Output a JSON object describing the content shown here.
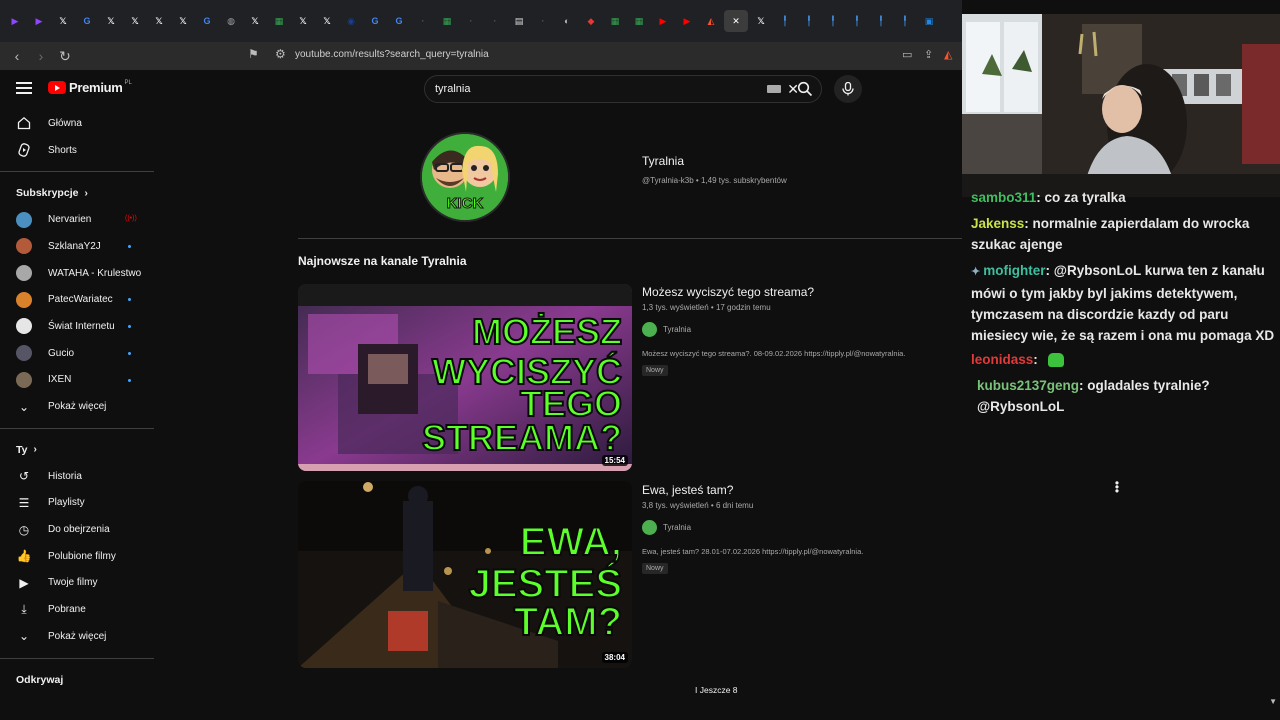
{
  "browser": {
    "tabs": [
      {
        "icon": "twitch-icon",
        "color": "#9146ff",
        "glyph": "▶"
      },
      {
        "icon": "twitch-icon",
        "color": "#9146ff",
        "glyph": "▶"
      },
      {
        "icon": "x-icon",
        "color": "#ffffff",
        "glyph": "𝕏"
      },
      {
        "icon": "google-icon",
        "color": "#4285f4",
        "glyph": "G"
      },
      {
        "icon": "x-icon",
        "color": "#ffffff",
        "glyph": "𝕏"
      },
      {
        "icon": "x-icon",
        "color": "#ffffff",
        "glyph": "𝕏"
      },
      {
        "icon": "x-icon",
        "color": "#ffffff",
        "glyph": "𝕏"
      },
      {
        "icon": "x-icon",
        "color": "#ffffff",
        "glyph": "𝕏"
      },
      {
        "icon": "google-icon",
        "color": "#4285f4",
        "glyph": "G"
      },
      {
        "icon": "globe-icon",
        "color": "#9aa0a6",
        "glyph": "◍"
      },
      {
        "icon": "x-icon",
        "color": "#ffffff",
        "glyph": "𝕏"
      },
      {
        "icon": "sheets-icon",
        "color": "#34a853",
        "glyph": "▦"
      },
      {
        "icon": "x-icon",
        "color": "#ffffff",
        "glyph": "𝕏"
      },
      {
        "icon": "x-icon",
        "color": "#ffffff",
        "glyph": "𝕏"
      },
      {
        "icon": "ford-icon",
        "color": "#1a3e8c",
        "glyph": "◉"
      },
      {
        "icon": "google-icon",
        "color": "#4285f4",
        "glyph": "G"
      },
      {
        "icon": "google-icon",
        "color": "#4285f4",
        "glyph": "G"
      },
      {
        "icon": "blank-icon",
        "color": "#555555",
        "glyph": "·"
      },
      {
        "icon": "sheets-icon",
        "color": "#34a853",
        "glyph": "▦"
      },
      {
        "icon": "blank-icon",
        "color": "#555555",
        "glyph": "·"
      },
      {
        "icon": "blank-icon",
        "color": "#555555",
        "glyph": "·"
      },
      {
        "icon": "doc-icon",
        "color": "#dddddd",
        "glyph": "▤"
      },
      {
        "icon": "blank-icon",
        "color": "#555555",
        "glyph": "·"
      },
      {
        "icon": "dark-icon",
        "color": "#bbbbbb",
        "glyph": "◐"
      },
      {
        "icon": "red-logo-icon",
        "color": "#e53935",
        "glyph": "◆"
      },
      {
        "icon": "sheets-icon",
        "color": "#34a853",
        "glyph": "▦"
      },
      {
        "icon": "sheets-icon",
        "color": "#34a853",
        "glyph": "▦"
      },
      {
        "icon": "youtube-icon",
        "color": "#ff0000",
        "glyph": "▶"
      },
      {
        "icon": "youtube-icon",
        "color": "#ff0000",
        "glyph": "▶"
      },
      {
        "icon": "brave-icon",
        "color": "#fb542b",
        "glyph": "◭"
      },
      {
        "icon": "close-icon",
        "color": "#ffffff",
        "glyph": "✕",
        "active": true
      },
      {
        "icon": "x-icon",
        "color": "#ffffff",
        "glyph": "𝕏"
      },
      {
        "icon": "pin-icon",
        "color": "#4aa3ff",
        "glyph": "╿"
      },
      {
        "icon": "pin-icon",
        "color": "#4aa3ff",
        "glyph": "╿"
      },
      {
        "icon": "pin-icon",
        "color": "#4aa3ff",
        "glyph": "╿"
      },
      {
        "icon": "pin-icon",
        "color": "#4aa3ff",
        "glyph": "╿"
      },
      {
        "icon": "pin-icon",
        "color": "#4aa3ff",
        "glyph": "╿"
      },
      {
        "icon": "pin-icon",
        "color": "#4aa3ff",
        "glyph": "╿"
      },
      {
        "icon": "app-icon",
        "color": "#1e88e5",
        "glyph": "▣"
      }
    ],
    "url": "youtube.com/results?search_query=tyralnia"
  },
  "youtube": {
    "logo_text": "Premium",
    "logo_region": "PL",
    "search": {
      "value": "tyralnia"
    },
    "sidebar": {
      "main": [
        {
          "label": "Główna",
          "icon": "home-icon"
        },
        {
          "label": "Shorts",
          "icon": "shorts-icon"
        }
      ],
      "subscriptions_title": "Subskrypcje",
      "subscriptions": [
        {
          "label": "Nervarien",
          "color": "#4a8fbf",
          "badge": "live"
        },
        {
          "label": "SzklanaY2J",
          "color": "#b35a3a",
          "badge": "dot"
        },
        {
          "label": "WATAHA - Krulestwo",
          "color": "#a8a8a8",
          "badge": ""
        },
        {
          "label": "PatecWariatec",
          "color": "#d9822b",
          "badge": "dot"
        },
        {
          "label": "Świat Internetu",
          "color": "#e6e6e6",
          "badge": "dot"
        },
        {
          "label": "Gucio",
          "color": "#555566",
          "badge": "dot"
        },
        {
          "label": "IXEN",
          "color": "#7a6a55",
          "badge": "dot"
        }
      ],
      "show_more_1": "Pokaż więcej",
      "you_title": "Ty",
      "you": [
        {
          "label": "Historia",
          "icon": "history-icon",
          "glyph": "↺"
        },
        {
          "label": "Playlisty",
          "icon": "playlist-icon",
          "glyph": "☰"
        },
        {
          "label": "Do obejrzenia",
          "icon": "clock-icon",
          "glyph": "◷"
        },
        {
          "label": "Polubione filmy",
          "icon": "thumbs-up-icon",
          "glyph": "👍"
        },
        {
          "label": "Twoje filmy",
          "icon": "video-icon",
          "glyph": "▶"
        },
        {
          "label": "Pobrane",
          "icon": "download-icon",
          "glyph": "⤓"
        }
      ],
      "show_more_2": "Pokaż więcej",
      "explore_title": "Odkrywaj"
    },
    "channel": {
      "name": "Tyralnia",
      "meta": "@Tyralnia-k3b • 1,49 tys. subskrybentów",
      "avatar_text": "KICK"
    },
    "section_title": "Najnowsze na kanale Tyralnia",
    "videos": [
      {
        "title": "Możesz wyciszyć tego streama?",
        "meta": "1,3 tys. wyświetleń • 17 godzin temu",
        "channel": "Tyralnia",
        "description": "Możesz wyciszyć tego streama?. 08-09.02.2026 https://tipply.pl/@nowatyralnia.",
        "badge": "Nowy",
        "duration": "15:54",
        "thumb_lines": [
          "MOŻESZ",
          "WYCISZYĆ",
          "TEGO",
          "STREAMA?"
        ]
      },
      {
        "title": "Ewa, jesteś tam?",
        "meta": "3,8 tys. wyświetleń • 6 dni temu",
        "channel": "Tyralnia",
        "description": "Ewa, jesteś tam? 28.01-07.02.2026 https://tipply.pl/@nowatyralnia.",
        "badge": "Nowy",
        "duration": "38:04",
        "thumb_lines": [
          "EWA,",
          "JESTEŚ",
          "TAM?"
        ]
      }
    ],
    "more_label": "I Jeszcze 8"
  },
  "chat": {
    "messages": [
      {
        "user": "sambo311",
        "user_color": "#3fbf5f",
        "text": ": co za tyralka"
      },
      {
        "user": "Jakenss",
        "user_color": "#c8e24a",
        "text": ": normalnie zapierdalam do wrocka szukac ajenge"
      },
      {
        "user": "mofighter",
        "user_color": "#3fbf9f",
        "text": ": @RybsonLoL kurwa ten z kanału mówi o tym jakby byl jakims detektywem, tymczasem na discordzie kazdy od paru miesiecy wie, że są razem i ona mu pomaga XD",
        "prefix_icon": "badge-icon"
      },
      {
        "user": "leonidass",
        "user_color": "#e03a3a",
        "text": ":",
        "emote": "green-emote"
      },
      {
        "user": "kubus2137geng",
        "user_color": "#7ac27a",
        "text": ": ogladales tyralnie? @RybsonLoL"
      }
    ]
  }
}
